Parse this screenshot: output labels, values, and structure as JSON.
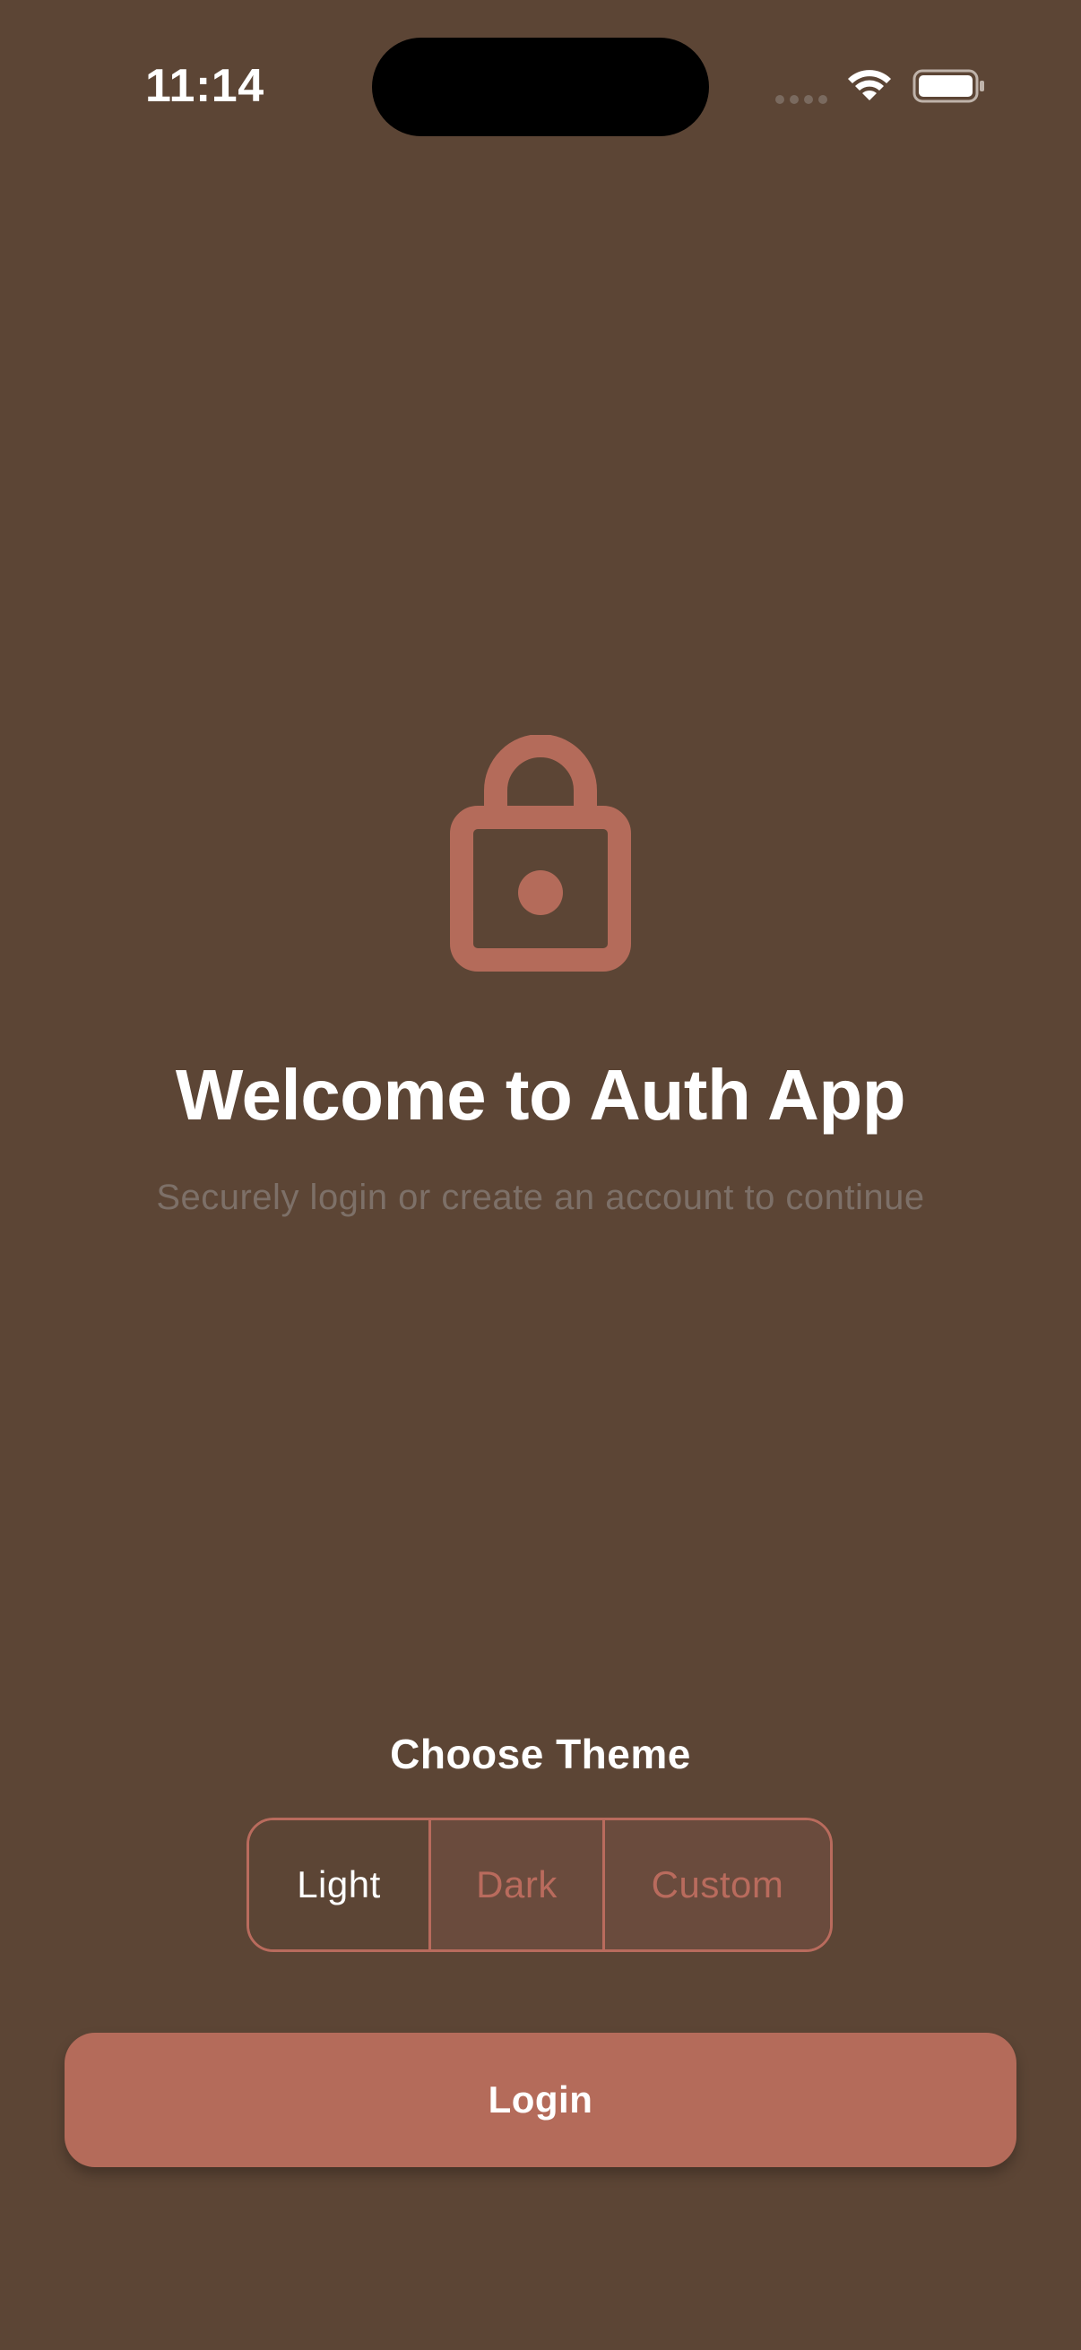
{
  "status_bar": {
    "time": "11:14",
    "signal_icon": "cellular-signal-icon",
    "wifi_icon": "wifi-icon",
    "battery_icon": "battery-icon"
  },
  "hero": {
    "icon": "lock-icon",
    "title": "Welcome to Auth App",
    "subtitle": "Securely login or create an account to continue"
  },
  "theme": {
    "heading": "Choose Theme",
    "options": [
      {
        "label": "Light",
        "selected": true
      },
      {
        "label": "Dark",
        "selected": false
      },
      {
        "label": "Custom",
        "selected": false
      }
    ]
  },
  "actions": {
    "login_label": "Login"
  },
  "colors": {
    "background": "#5c4535",
    "accent": "#b46b5a",
    "subtitle_text": "#7d7068"
  }
}
